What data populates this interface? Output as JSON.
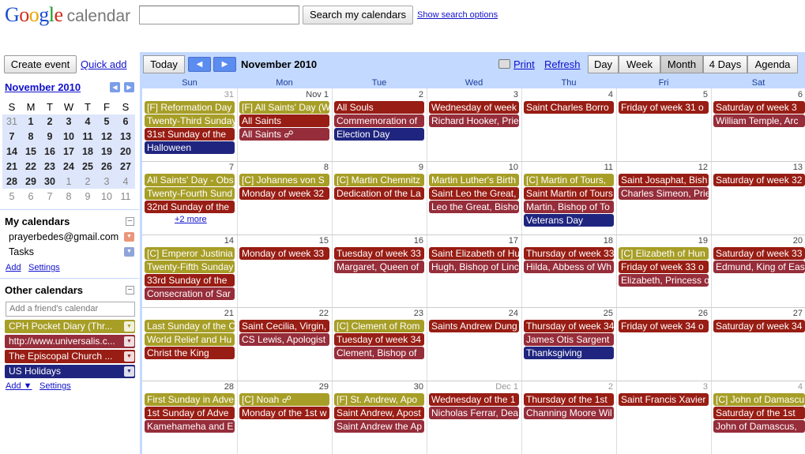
{
  "header": {
    "logo_google": "Google",
    "logo_calendar": "calendar",
    "search_value": "",
    "search_button": "Search my calendars",
    "search_options": "Show search options"
  },
  "sidebar": {
    "create_event": "Create event",
    "quick_add": "Quick add",
    "mini_month": "November 2010",
    "weekdays": [
      "S",
      "M",
      "T",
      "W",
      "T",
      "F",
      "S"
    ],
    "mini_weeks": [
      [
        "31",
        "1",
        "2",
        "3",
        "4",
        "5",
        "6"
      ],
      [
        "7",
        "8",
        "9",
        "10",
        "11",
        "12",
        "13"
      ],
      [
        "14",
        "15",
        "16",
        "17",
        "18",
        "19",
        "20"
      ],
      [
        "21",
        "22",
        "23",
        "24",
        "25",
        "26",
        "27"
      ],
      [
        "28",
        "29",
        "30",
        "1",
        "2",
        "3",
        "4"
      ],
      [
        "5",
        "6",
        "7",
        "8",
        "9",
        "10",
        "11"
      ]
    ],
    "my_calendars_title": "My calendars",
    "my_calendars": [
      {
        "label": "prayerbedes@gmail.com",
        "color": "#e9967a"
      },
      {
        "label": "Tasks",
        "color": "#8fa4d8"
      }
    ],
    "my_links": {
      "add": "Add",
      "settings": "Settings"
    },
    "other_calendars_title": "Other calendars",
    "friend_placeholder": "Add a friend's calendar",
    "other_calendars": [
      {
        "label": "CPH Pocket Diary (Thr...",
        "color": "#a79e27"
      },
      {
        "label": "http://www.universalis.c...",
        "color": "#962d3a"
      },
      {
        "label": "The Episcopal Church ...",
        "color": "#981d14"
      },
      {
        "label": "US Holidays",
        "color": "#1f257f"
      }
    ],
    "other_links": {
      "add": "Add ▼",
      "settings": "Settings"
    }
  },
  "toolbar": {
    "today": "Today",
    "prev_icon": "◀",
    "next_icon": "▶",
    "month_title": "November 2010",
    "print": "Print",
    "refresh": "Refresh",
    "views": [
      "Day",
      "Week",
      "Month",
      "4 Days",
      "Agenda"
    ],
    "selected_view": "Month"
  },
  "calendar": {
    "colors": {
      "olive": "#a79e27",
      "red": "#981d14",
      "maroon": "#962d3a",
      "navy": "#1f257f"
    },
    "weekday_names": [
      "Sun",
      "Mon",
      "Tue",
      "Wed",
      "Thu",
      "Fri",
      "Sat"
    ],
    "weeks": [
      {
        "days": [
          {
            "num": "31",
            "out": true,
            "events": [
              {
                "t": "[F] Reformation Day",
                "c": "olive"
              },
              {
                "t": "Twenty-Third Sunday",
                "c": "olive"
              },
              {
                "t": "31st Sunday of the",
                "c": "red"
              },
              {
                "t": "Halloween",
                "c": "navy"
              }
            ]
          },
          {
            "num": "Nov 1",
            "events": [
              {
                "t": "[F] All Saints' Day (W",
                "c": "olive"
              },
              {
                "t": "All Saints",
                "c": "red"
              },
              {
                "t": "All Saints ☍",
                "c": "maroon"
              }
            ]
          },
          {
            "num": "2",
            "events": [
              {
                "t": "All Souls",
                "c": "red"
              },
              {
                "t": "Commemoration of",
                "c": "maroon"
              },
              {
                "t": "Election Day",
                "c": "navy"
              }
            ]
          },
          {
            "num": "3",
            "events": [
              {
                "t": "Wednesday of week",
                "c": "red"
              },
              {
                "t": "Richard Hooker, Prie",
                "c": "maroon"
              }
            ]
          },
          {
            "num": "4",
            "events": [
              {
                "t": "Saint Charles Borro",
                "c": "red"
              }
            ]
          },
          {
            "num": "5",
            "events": [
              {
                "t": "Friday of week 31 o",
                "c": "red"
              }
            ]
          },
          {
            "num": "6",
            "events": [
              {
                "t": "Saturday of week 3",
                "c": "red"
              },
              {
                "t": "William Temple, Arc",
                "c": "maroon"
              }
            ]
          }
        ]
      },
      {
        "days": [
          {
            "num": "7",
            "events": [
              {
                "t": "All Saints' Day - Obs",
                "c": "olive"
              },
              {
                "t": "Twenty-Fourth Sund",
                "c": "olive"
              },
              {
                "t": "32nd Sunday of the",
                "c": "red"
              }
            ],
            "more": "+2 more"
          },
          {
            "num": "8",
            "events": [
              {
                "t": "[C] Johannes von S",
                "c": "olive"
              },
              {
                "t": "Monday of week 32",
                "c": "red"
              }
            ]
          },
          {
            "num": "9",
            "events": [
              {
                "t": "[C] Martin Chemnitz",
                "c": "olive"
              },
              {
                "t": "Dedication of the La",
                "c": "red"
              }
            ]
          },
          {
            "num": "10",
            "events": [
              {
                "t": "Martin Luther's Birth",
                "c": "olive"
              },
              {
                "t": "Saint Leo the Great,",
                "c": "red"
              },
              {
                "t": "Leo the Great, Bisho",
                "c": "maroon"
              }
            ]
          },
          {
            "num": "11",
            "events": [
              {
                "t": "[C] Martin of Tours,",
                "c": "olive"
              },
              {
                "t": "Saint Martin of Tours",
                "c": "red"
              },
              {
                "t": "Martin, Bishop of To",
                "c": "maroon"
              },
              {
                "t": "Veterans Day",
                "c": "navy"
              }
            ]
          },
          {
            "num": "12",
            "events": [
              {
                "t": "Saint Josaphat, Bish",
                "c": "red"
              },
              {
                "t": "Charles Simeon, Prie",
                "c": "maroon"
              }
            ]
          },
          {
            "num": "13",
            "events": [
              {
                "t": "Saturday of week 32",
                "c": "red"
              }
            ]
          }
        ]
      },
      {
        "days": [
          {
            "num": "14",
            "events": [
              {
                "t": "[C] Emperor Justinia",
                "c": "olive"
              },
              {
                "t": "Twenty-Fifth Sunday",
                "c": "olive"
              },
              {
                "t": "33rd Sunday of the",
                "c": "red"
              },
              {
                "t": "Consecration of Sar",
                "c": "maroon"
              }
            ]
          },
          {
            "num": "15",
            "events": [
              {
                "t": "Monday of week 33",
                "c": "red"
              }
            ]
          },
          {
            "num": "16",
            "events": [
              {
                "t": "Tuesday of week 33",
                "c": "red"
              },
              {
                "t": "Margaret, Queen of",
                "c": "maroon"
              }
            ]
          },
          {
            "num": "17",
            "events": [
              {
                "t": "Saint Elizabeth of Hu",
                "c": "red"
              },
              {
                "t": "Hugh, Bishop of Linc",
                "c": "maroon"
              }
            ]
          },
          {
            "num": "18",
            "events": [
              {
                "t": "Thursday of week 33",
                "c": "red"
              },
              {
                "t": "Hilda, Abbess of Wh",
                "c": "maroon"
              }
            ]
          },
          {
            "num": "19",
            "events": [
              {
                "t": "[C] Elizabeth of Hun",
                "c": "olive"
              },
              {
                "t": "Friday of week 33 o",
                "c": "red"
              },
              {
                "t": "Elizabeth, Princess o",
                "c": "maroon"
              }
            ]
          },
          {
            "num": "20",
            "events": [
              {
                "t": "Saturday of week 33",
                "c": "red"
              },
              {
                "t": "Edmund, King of Eas",
                "c": "maroon"
              }
            ]
          }
        ]
      },
      {
        "days": [
          {
            "num": "21",
            "events": [
              {
                "t": "Last Sunday of the C",
                "c": "olive"
              },
              {
                "t": "World Relief and Hu",
                "c": "olive"
              },
              {
                "t": "Christ the King",
                "c": "red"
              }
            ]
          },
          {
            "num": "22",
            "events": [
              {
                "t": "Saint Cecilia, Virgin,",
                "c": "red"
              },
              {
                "t": "CS Lewis, Apologist",
                "c": "maroon"
              }
            ]
          },
          {
            "num": "23",
            "events": [
              {
                "t": "[C] Clement of Rom",
                "c": "olive"
              },
              {
                "t": "Tuesday of week 34",
                "c": "red"
              },
              {
                "t": "Clement, Bishop of",
                "c": "maroon"
              }
            ]
          },
          {
            "num": "24",
            "events": [
              {
                "t": "Saints Andrew Dung",
                "c": "red"
              }
            ]
          },
          {
            "num": "25",
            "events": [
              {
                "t": "Thursday of week 34",
                "c": "red"
              },
              {
                "t": "James Otis Sargent",
                "c": "maroon"
              },
              {
                "t": "Thanksgiving",
                "c": "navy"
              }
            ]
          },
          {
            "num": "26",
            "events": [
              {
                "t": "Friday of week 34 o",
                "c": "red"
              }
            ]
          },
          {
            "num": "27",
            "events": [
              {
                "t": "Saturday of week 34",
                "c": "red"
              }
            ]
          }
        ]
      },
      {
        "days": [
          {
            "num": "28",
            "events": [
              {
                "t": "First Sunday in Adve",
                "c": "olive"
              },
              {
                "t": "1st Sunday of Adve",
                "c": "red"
              },
              {
                "t": "Kamehameha and E",
                "c": "maroon"
              }
            ]
          },
          {
            "num": "29",
            "events": [
              {
                "t": "[C] Noah ☍",
                "c": "olive"
              },
              {
                "t": "Monday of the 1st w",
                "c": "red"
              }
            ]
          },
          {
            "num": "30",
            "events": [
              {
                "t": "[F] St. Andrew, Apo",
                "c": "olive"
              },
              {
                "t": "Saint Andrew, Apost",
                "c": "red"
              },
              {
                "t": "Saint Andrew the Ap",
                "c": "maroon"
              }
            ]
          },
          {
            "num": "Dec 1",
            "out": true,
            "events": [
              {
                "t": "Wednesday of the 1",
                "c": "red"
              },
              {
                "t": "Nicholas Ferrar, Dea",
                "c": "maroon"
              }
            ]
          },
          {
            "num": "2",
            "out": true,
            "events": [
              {
                "t": "Thursday of the 1st",
                "c": "red"
              },
              {
                "t": "Channing Moore Wil",
                "c": "maroon"
              }
            ]
          },
          {
            "num": "3",
            "out": true,
            "events": [
              {
                "t": "Saint Francis Xavier",
                "c": "red"
              }
            ]
          },
          {
            "num": "4",
            "out": true,
            "events": [
              {
                "t": "[C] John of Damascu",
                "c": "olive"
              },
              {
                "t": "Saturday of the 1st",
                "c": "red"
              },
              {
                "t": "John of Damascus,",
                "c": "maroon"
              }
            ]
          }
        ]
      }
    ]
  }
}
